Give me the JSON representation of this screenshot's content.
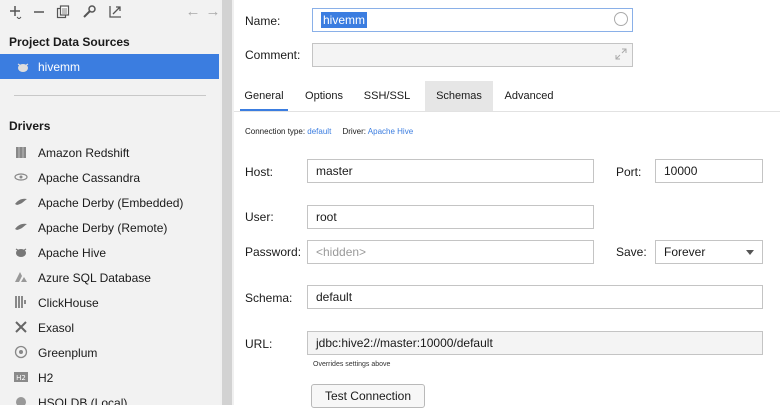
{
  "sidebar": {
    "toolbar": {
      "add_icon": "+",
      "remove_icon": "−",
      "back_icon": "←",
      "forward_icon": "→"
    },
    "project_sources_title": "Project Data Sources",
    "data_sources": [
      {
        "label": "hivemm",
        "icon": "hive-icon",
        "selected": true
      }
    ],
    "drivers_title": "Drivers",
    "drivers": [
      {
        "label": "Amazon Redshift",
        "icon": "redshift-icon"
      },
      {
        "label": "Apache Cassandra",
        "icon": "cassandra-icon"
      },
      {
        "label": "Apache Derby (Embedded)",
        "icon": "derby-icon"
      },
      {
        "label": "Apache Derby (Remote)",
        "icon": "derby-icon"
      },
      {
        "label": "Apache Hive",
        "icon": "hive-icon"
      },
      {
        "label": "Azure SQL Database",
        "icon": "azure-icon"
      },
      {
        "label": "ClickHouse",
        "icon": "clickhouse-icon"
      },
      {
        "label": "Exasol",
        "icon": "exasol-icon"
      },
      {
        "label": "Greenplum",
        "icon": "greenplum-icon"
      },
      {
        "label": "H2",
        "icon": "h2-icon"
      },
      {
        "label": "HSQLDB (Local)",
        "icon": "hsqldb-icon"
      }
    ]
  },
  "form": {
    "name_label": "Name:",
    "name_value": "hivemm",
    "comment_label": "Comment:",
    "comment_value": "",
    "tabs": [
      {
        "label": "General",
        "active": true
      },
      {
        "label": "Options",
        "active": false
      },
      {
        "label": "SSH/SSL",
        "active": false
      },
      {
        "label": "Schemas",
        "active": false,
        "hover": true
      },
      {
        "label": "Advanced",
        "active": false
      }
    ],
    "connection_type_label": "Connection type:",
    "connection_type_value": "default",
    "driver_label": "Driver:",
    "driver_value": "Apache Hive",
    "host_label": "Host:",
    "host_value": "master",
    "port_label": "Port:",
    "port_value": "10000",
    "user_label": "User:",
    "user_value": "root",
    "password_label": "Password:",
    "password_placeholder": "<hidden>",
    "save_label": "Save:",
    "save_value": "Forever",
    "schema_label": "Schema:",
    "schema_value": "default",
    "url_label": "URL:",
    "url_value": "jdbc:hive2://master:10000/default",
    "url_note": "Overrides settings above",
    "test_connection_label": "Test Connection"
  },
  "colors": {
    "accent": "#3b7de0",
    "sidebar_bg": "#f2f2f2"
  }
}
